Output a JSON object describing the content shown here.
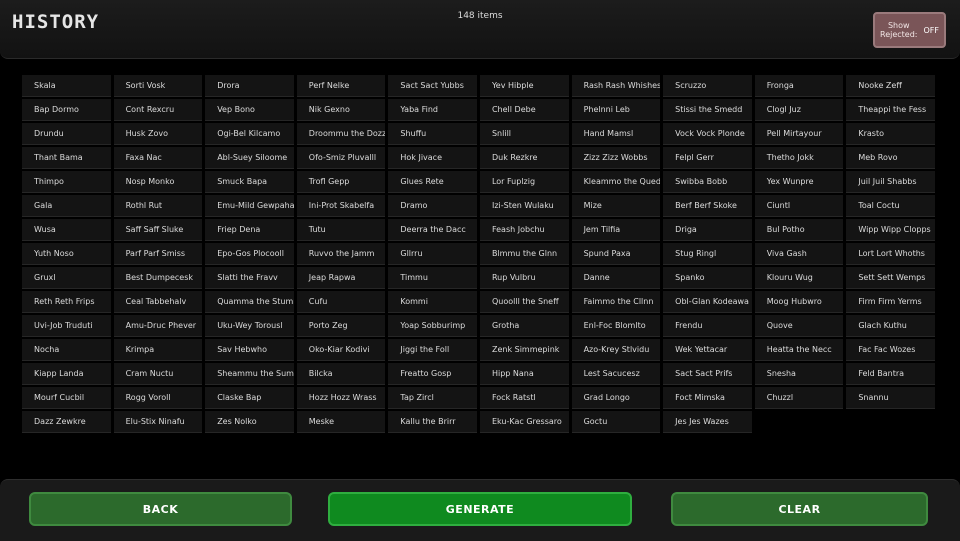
{
  "header": {
    "title": "HISTORY",
    "count": "148 items"
  },
  "toggle": {
    "label_line1": "Show",
    "label_line2": "Rejected:",
    "state": "OFF"
  },
  "names": [
    "Skala",
    "Sorti Vosk",
    "Drora",
    "Perf Nelke",
    "Sact Sact Yubbs",
    "Yev Hibple",
    "Rash Rash Whishes",
    "Scruzzo",
    "Fronga",
    "Nooke Zeff",
    "Bap Dormo",
    "Cont Rexcru",
    "Vep Bono",
    "Nik Gexno",
    "Yaba Find",
    "Chell Debe",
    "Phelnni Leb",
    "Stissi the Smedd",
    "Clogl Juz",
    "Theappi the Fess",
    "Drundu",
    "Husk Zovo",
    "Ogi-Bel Kilcamo",
    "Droommu the Dozz",
    "Shuffu",
    "Snlill",
    "Hand Mamsl",
    "Vock Vock Plonde",
    "Pell Mirtayour",
    "Krasto",
    "Thant Bama",
    "Faxa Nac",
    "Abl-Suey Siloome",
    "Ofo-Smiz Pluvalll",
    "Hok Jivace",
    "Duk Rezkre",
    "Zizz Zizz Wobbs",
    "Felpl Gerr",
    "Thetho Jokk",
    "Meb Rovo",
    "Thimpo",
    "Nosp Monko",
    "Smuck Bapa",
    "Trofl Gepp",
    "Glues Rete",
    "Lor Fuplzig",
    "Kleammo the Quedd",
    "Swibba Bobb",
    "Yex Wunpre",
    "Juil Juil Shabbs",
    "Gala",
    "Rothl Rut",
    "Emu-Mild Gewpaha",
    "Ini-Prot Skabelfa",
    "Dramo",
    "Izi-Sten Wulaku",
    "Mize",
    "Berf Berf Skoke",
    "Ciuntl",
    "Toal Coctu",
    "Wusa",
    "Saff Saff Sluke",
    "Friep Dena",
    "Tutu",
    "Deerra the Dacc",
    "Feash Jobchu",
    "Jem Tilfia",
    "Driga",
    "Bul Potho",
    "Wipp Wipp Clopps",
    "Yuth Noso",
    "Parf Parf Smiss",
    "Epo-Gos Plocooll",
    "Ruvvo the Jamm",
    "Gllrru",
    "Blmmu the Glnn",
    "Spund Paxa",
    "Stug Ringl",
    "Viva Gash",
    "Lort Lort Whoths",
    "Gruxl",
    "Best Dumpecesk",
    "Slatti the Fravv",
    "Jeap Rapwa",
    "Timmu",
    "Rup Vulbru",
    "Danne",
    "Spanko",
    "Klouru Wug",
    "Sett Sett Wemps",
    "Reth Reth Frips",
    "Ceal Tabbehalv",
    "Quamma the Stumm",
    "Cufu",
    "Kommi",
    "Quoolll the Sneff",
    "Faimmo the Cllnn",
    "Obl-Glan Kodeawa",
    "Moog Hubwro",
    "Firm Firm Yerms",
    "Uvi-Job Truduti",
    "Amu-Druc Phever",
    "Uku-Wey Torousl",
    "Porto Zeg",
    "Yoap Sobburimp",
    "Grotha",
    "Enl-Foc Blomlto",
    "Frendu",
    "Quove",
    "Glach Kuthu",
    "Nocha",
    "Krimpa",
    "Sav Hebwho",
    "Oko-Kiar Kodivi",
    "Jiggi the Foll",
    "Zenk Simmepink",
    "Azo-Krey Stlvidu",
    "Wek Yettacar",
    "Heatta the Necc",
    "Fac Fac Wozes",
    "Kiapp Landa",
    "Cram Nuctu",
    "Sheammu the Summ",
    "Bilcka",
    "Freatto Gosp",
    "Hipp Nana",
    "Lest Sacucesz",
    "Sact Sact Prifs",
    "Snesha",
    "Feld Bantra",
    "Mourf Cucbil",
    "Rogg Voroll",
    "Claske Bap",
    "Hozz Hozz Wrass",
    "Tap Zircl",
    "Fock Ratstl",
    "Grad Longo",
    "Foct Mimska",
    "Chuzzl",
    "Snannu",
    "Dazz Zewkre",
    "Elu-Stix Ninafu",
    "Zes Nolko",
    "Meske",
    "Kallu the Brirr",
    "Eku-Kac Gressaro",
    "Goctu",
    "Jes Jes Wazes"
  ],
  "footer": {
    "back": "BACK",
    "generate": "GENERATE",
    "clear": "CLEAR"
  },
  "colors": {
    "accent": "#0f8a1f",
    "button_secondary": "#2c6a2c",
    "toggle_bg": "#7a5558",
    "cell_bg": "#141414",
    "page_bg": "#000000"
  }
}
